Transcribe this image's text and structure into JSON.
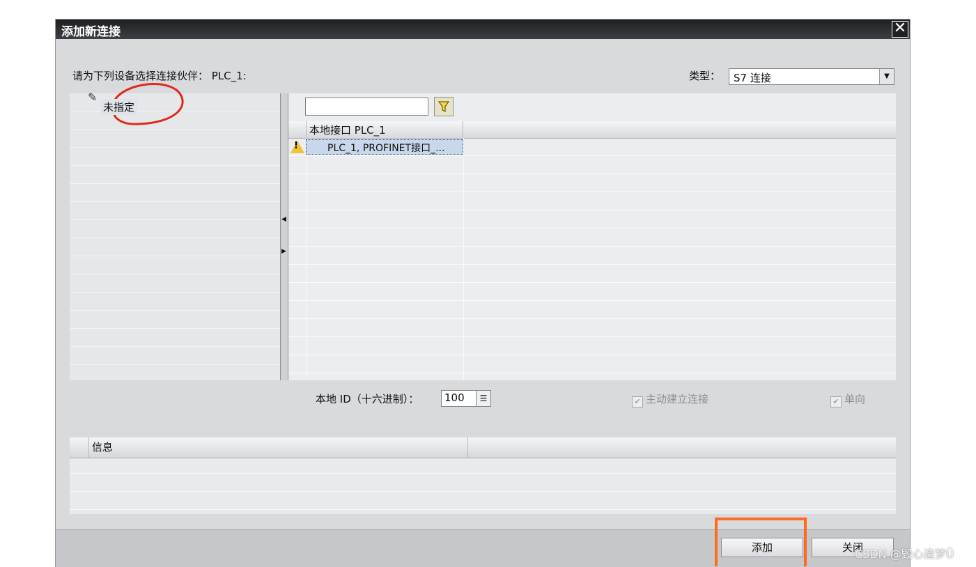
{
  "dialog": {
    "title": "添加新连接",
    "close_label": "✕"
  },
  "partner": {
    "prompt": "请为下列设备选择连接伙伴： PLC_1:",
    "type_label": "类型：",
    "type_value": "S7 连接",
    "tree_items": [
      "未指定"
    ]
  },
  "interfaces": {
    "filter_value": "",
    "column_header": "本地接口 PLC_1",
    "rows": [
      "PLC_1, PROFINET接口_..."
    ]
  },
  "options": {
    "local_id_label": "本地 ID（十六进制）：",
    "local_id_value": "100",
    "active_connect_label": "主动建立连接",
    "oneway_label": "单向"
  },
  "info": {
    "header": "信息"
  },
  "footer": {
    "add_label": "添加",
    "close_label": "关闭"
  },
  "watermark": "CSDN @毁心造梦Ü",
  "colors": {
    "highlight": "#ff6a1f",
    "annotation": "#e0281c",
    "selection": "#c9d7ea"
  }
}
